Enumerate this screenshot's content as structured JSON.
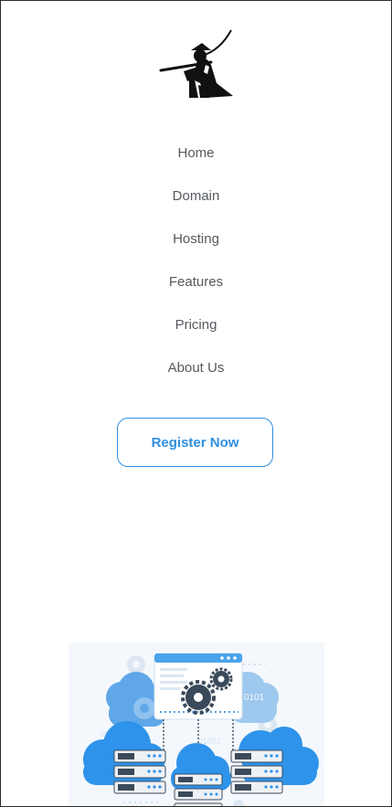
{
  "nav": {
    "items": [
      {
        "label": "Home"
      },
      {
        "label": "Domain"
      },
      {
        "label": "Hosting"
      },
      {
        "label": "Features"
      },
      {
        "label": "Pricing"
      },
      {
        "label": "About Us"
      }
    ]
  },
  "cta": {
    "register_label": "Register Now"
  },
  "hero": {
    "binary_text_1": "0101",
    "binary_text_2": "0010100010",
    "binary_text_3": "01001"
  },
  "colors": {
    "accent": "#2f8fe0",
    "nav_text": "#555a5f",
    "cloud": "#2e93ea",
    "server": "#eef1f5"
  },
  "icons": {
    "logo": "samurai-logo-icon",
    "hero": "cloud-servers-gear-illustration"
  }
}
